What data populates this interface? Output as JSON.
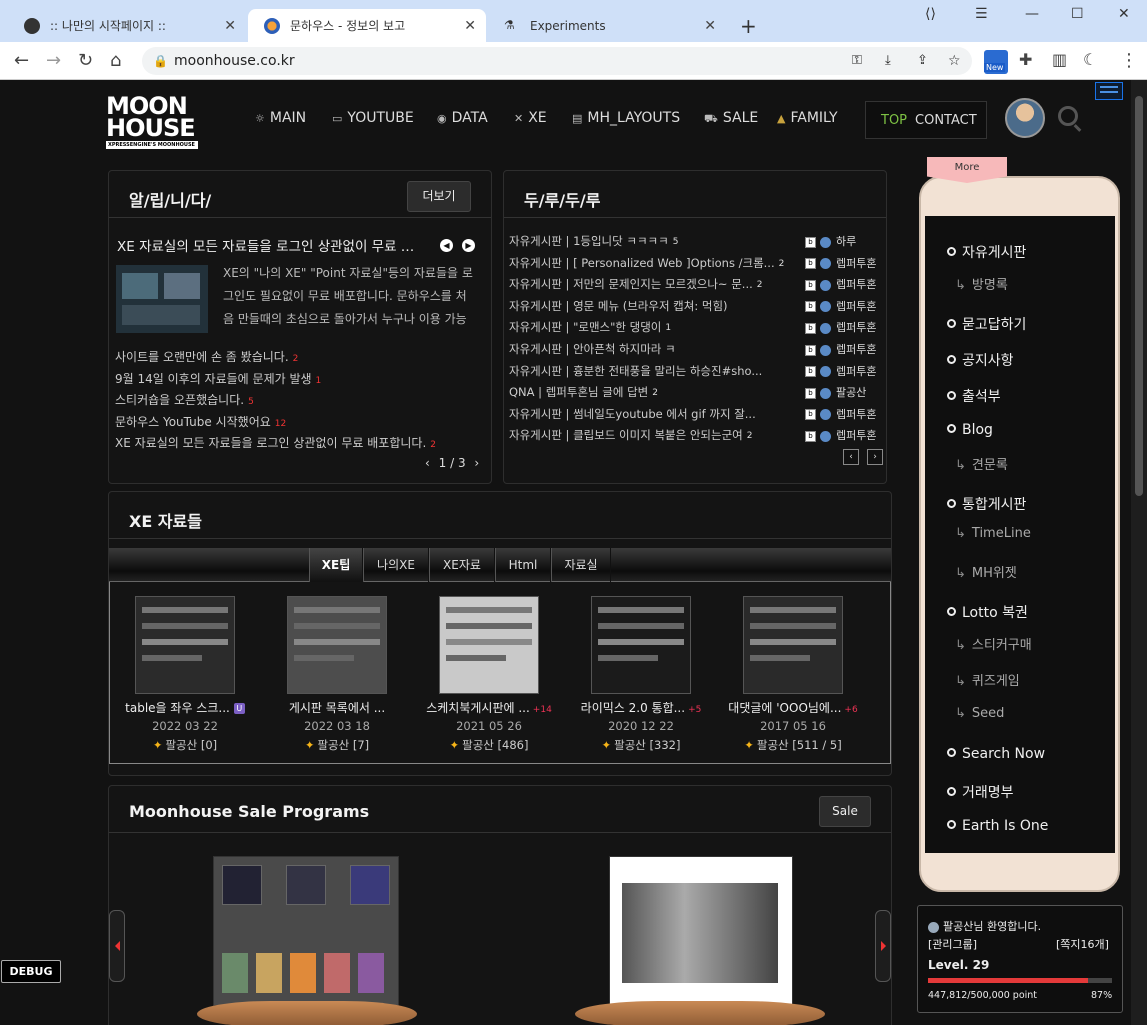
{
  "browser": {
    "tabs": [
      {
        "title": ":: 나만의 시작페이지 ::"
      },
      {
        "title": "문하우스 - 정보의 보고"
      },
      {
        "title": "Experiments"
      }
    ],
    "url": "moonhouse.co.kr",
    "new_badge": "New"
  },
  "site": {
    "logo_line1": "MOON",
    "logo_line2": "HOUSE",
    "logo_sub": "XPRESSENGINE'S MOONHOUSE",
    "nav": [
      {
        "icon": "☼",
        "label": "MAIN"
      },
      {
        "icon": "▭",
        "label": "YOUTUBE"
      },
      {
        "icon": "◉",
        "label": "DATA"
      },
      {
        "icon": "✕",
        "label": "XE"
      },
      {
        "icon": "▤",
        "label": "MH_LAYOUTS"
      },
      {
        "icon": "⛟",
        "label": "SALE"
      },
      {
        "icon": "▲",
        "label": "FAMILY"
      }
    ],
    "top_label": "TOP",
    "contact_label": "CONTACT"
  },
  "notice": {
    "title": "알/립/니/다/",
    "more": "더보기",
    "headline": "XE 자료실의 모든 자료들을 로그인 상관없이 무료 …",
    "summary_lines": [
      "XE의 \"나의 XE\" \"Point 자료실\"등의 자료들을 로",
      "그인도 필요없이 무료 배포합니다. 문하우스를 처",
      "음 만들때의 초심으로 돌아가서 누구나 이용 가능"
    ],
    "items": [
      {
        "text": "사이트를 오랜만에 손 좀 봤습니다.",
        "count": "2"
      },
      {
        "text": "9월 14일 이후의 자료들에 문제가 발생",
        "count": "1"
      },
      {
        "text": "스티커숍을 오픈했습니다.",
        "count": "5"
      },
      {
        "text": "문하우스 YouTube 시작했어요",
        "count": "12"
      },
      {
        "text": "XE 자료실의 모든 자료들을 로그인 상관없이 무료 배포합니다.",
        "count": "2"
      }
    ],
    "pager": "1 / 3"
  },
  "board": {
    "title": "두/루/두/루",
    "rows": [
      {
        "text": "자유게시판 | 1등입니닷 ㅋㅋㅋㅋ",
        "count": "5",
        "author": "하루"
      },
      {
        "text": "자유게시판 | [ Personalized Web ]Options /크롬...",
        "count": "2",
        "author": "렙퍼투혼"
      },
      {
        "text": "자유게시판 | 저만의 문제인지는 모르겠으나~ 문...",
        "count": "2",
        "author": "렙퍼투혼"
      },
      {
        "text": "자유게시판 | 영문 메뉴 (브라우저 캡쳐: 먹힘)",
        "count": "",
        "author": "렙퍼투혼"
      },
      {
        "text": "자유게시판 | \"로맨스\"한 댕댕이",
        "count": "1",
        "author": "렙퍼투혼"
      },
      {
        "text": "자유게시판 | 안아픈척 하지마라 ㅋ",
        "count": "",
        "author": "렙퍼투혼"
      },
      {
        "text": "자유게시판 | 흉분한 전태풍을 말리는 하승진#sho...",
        "count": "",
        "author": "렙퍼투혼"
      },
      {
        "text": "QNA | 렙퍼투혼님 글에 답변",
        "count": "2",
        "author": "팔공산"
      },
      {
        "text": "자유게시판 | 썸네일도youtube 에서 gif 까지 잘...",
        "count": "",
        "author": "렙퍼투혼"
      },
      {
        "text": "자유게시판 | 클립보드 이미지 복붙은 안되는군여",
        "count": "2",
        "author": "렙퍼투혼"
      }
    ]
  },
  "xe": {
    "title": "XE 자료들",
    "tabs": [
      "XE팁",
      "나의XE",
      "XE자료",
      "Html",
      "자료실"
    ],
    "cards": [
      {
        "title": "table을 좌우 스크...",
        "date": "2022 03 22",
        "author": "팔공산",
        "stat": "[0]",
        "plus": "",
        "badge": "U"
      },
      {
        "title": "게시판 목록에서 ...",
        "date": "2022 03 18",
        "author": "팔공산",
        "stat": "[7]",
        "plus": "",
        "badge": ""
      },
      {
        "title": "스케치북게시판에 ...",
        "date": "2021 05 26",
        "author": "팔공산",
        "stat": "[486]",
        "plus": "+14",
        "badge": ""
      },
      {
        "title": "라이믹스 2.0 통합...",
        "date": "2020 12 22",
        "author": "팔공산",
        "stat": "[332]",
        "plus": "+5",
        "badge": ""
      },
      {
        "title": "대댓글에 'OOO님에...",
        "date": "2017 05 16",
        "author": "팔공산",
        "stat": "[511 / 5]",
        "plus": "+6",
        "badge": ""
      }
    ]
  },
  "sale": {
    "title": "Moonhouse Sale Programs",
    "button": "Sale"
  },
  "sidebar": {
    "more_label": "More",
    "menu": [
      {
        "label": "자유게시판",
        "sub": false
      },
      {
        "label": "방명록",
        "sub": true
      },
      {
        "label": "묻고답하기",
        "sub": false
      },
      {
        "label": "공지사항",
        "sub": false
      },
      {
        "label": "출석부",
        "sub": false
      },
      {
        "label": "Blog",
        "sub": false
      },
      {
        "label": "견문록",
        "sub": true
      },
      {
        "label": "통합게시판",
        "sub": false
      },
      {
        "label": "TimeLine",
        "sub": true
      },
      {
        "label": "MH위젯",
        "sub": true
      },
      {
        "label": "Lotto 복권",
        "sub": false
      },
      {
        "label": "스티커구매",
        "sub": true
      },
      {
        "label": "퀴즈게임",
        "sub": true
      },
      {
        "label": "Seed",
        "sub": true
      },
      {
        "label": "Search Now",
        "sub": false
      },
      {
        "label": "거래명부",
        "sub": false
      },
      {
        "label": "Earth Is One",
        "sub": false
      }
    ]
  },
  "user": {
    "greeting": "팔공산님 환영합니다.",
    "group": "[관리그룹]",
    "messages": "[쪽지16개]",
    "level": "Level. 29",
    "points": "447,812/500,000 point",
    "percent": "87%",
    "progress": 0.87
  },
  "debug_label": "DEBUG"
}
